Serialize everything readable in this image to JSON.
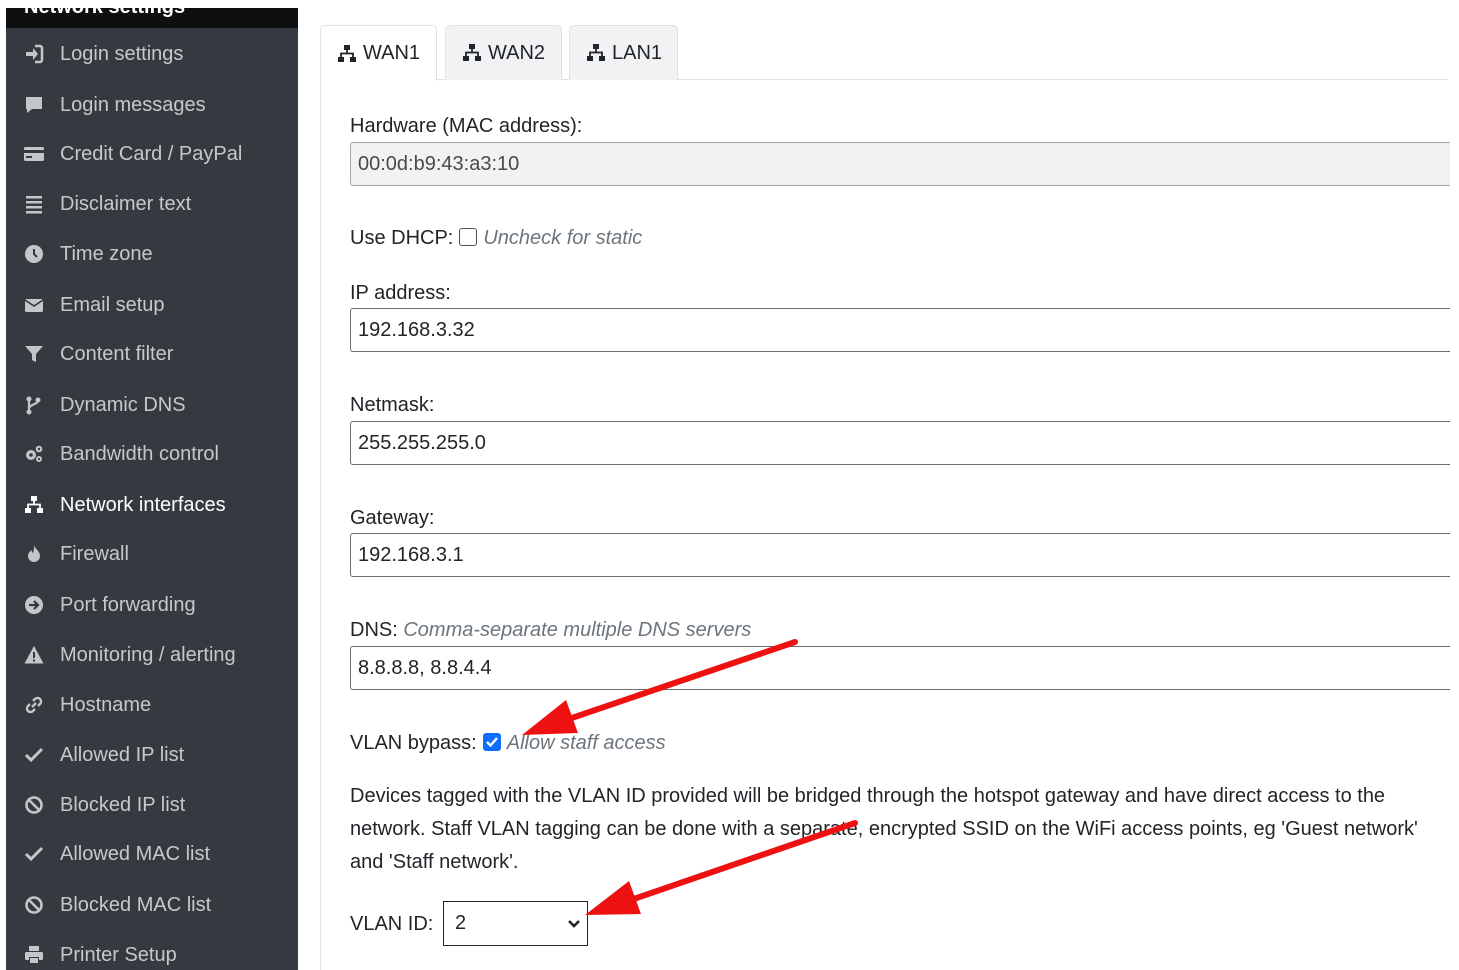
{
  "sidebar": {
    "header": "Network settings",
    "items": [
      {
        "label": "Login settings",
        "icon": "sign-in-icon",
        "active": false
      },
      {
        "label": "Login messages",
        "icon": "comment-icon",
        "active": false
      },
      {
        "label": "Credit Card / PayPal",
        "icon": "credit-card-icon",
        "active": false
      },
      {
        "label": "Disclaimer text",
        "icon": "align-justify-icon",
        "active": false
      },
      {
        "label": "Time zone",
        "icon": "clock-icon",
        "active": false
      },
      {
        "label": "Email setup",
        "icon": "envelope-icon",
        "active": false
      },
      {
        "label": "Content filter",
        "icon": "filter-icon",
        "active": false
      },
      {
        "label": "Dynamic DNS",
        "icon": "code-branch-icon",
        "active": false
      },
      {
        "label": "Bandwidth control",
        "icon": "cogs-icon",
        "active": false
      },
      {
        "label": "Network interfaces",
        "icon": "sitemap-icon",
        "active": true
      },
      {
        "label": "Firewall",
        "icon": "fire-icon",
        "active": false
      },
      {
        "label": "Port forwarding",
        "icon": "arrow-circle-right-icon",
        "active": false
      },
      {
        "label": "Monitoring / alerting",
        "icon": "warning-icon",
        "active": false
      },
      {
        "label": "Hostname",
        "icon": "link-icon",
        "active": false
      },
      {
        "label": "Allowed IP list",
        "icon": "check-icon",
        "active": false
      },
      {
        "label": "Blocked IP list",
        "icon": "ban-icon",
        "active": false
      },
      {
        "label": "Allowed MAC list",
        "icon": "check-icon",
        "active": false
      },
      {
        "label": "Blocked MAC list",
        "icon": "ban-icon",
        "active": false
      },
      {
        "label": "Printer Setup",
        "icon": "print-icon",
        "active": false
      }
    ]
  },
  "tabs": [
    {
      "label": "WAN1",
      "active": true
    },
    {
      "label": "WAN2",
      "active": false
    },
    {
      "label": "LAN1",
      "active": false
    }
  ],
  "form": {
    "mac_label": "Hardware (MAC address):",
    "mac_value": "00:0d:b9:43:a3:10",
    "dhcp_label": "Use DHCP:",
    "dhcp_checked": false,
    "dhcp_hint": "Uncheck for static",
    "ip_label": "IP address:",
    "ip_value": "192.168.3.32",
    "netmask_label": "Netmask:",
    "netmask_value": "255.255.255.0",
    "gateway_label": "Gateway:",
    "gateway_value": "192.168.3.1",
    "dns_label": "DNS:",
    "dns_hint": "Comma-separate multiple DNS servers",
    "dns_value": "8.8.8.8, 8.8.4.4",
    "vlan_bypass_label": "VLAN bypass:",
    "vlan_bypass_checked": true,
    "vlan_bypass_hint": "Allow staff access",
    "vlan_description": "Devices tagged with the VLAN ID provided will be bridged through the hotspot gateway and have direct access to the network. Staff VLAN tagging can be done with a separate, encrypted SSID on the WiFi access points, eg 'Guest network' and 'Staff network'.",
    "vlan_id_label": "VLAN ID:",
    "vlan_id_value": "2"
  },
  "annotations": {
    "arrow_color": "#ee1111",
    "arrows": [
      "arrow-pointing-to-vlan-bypass",
      "arrow-pointing-to-vlan-id"
    ]
  },
  "colors": {
    "sidebar_bg": "#343a40",
    "checkbox_accent": "#0d6efd"
  }
}
